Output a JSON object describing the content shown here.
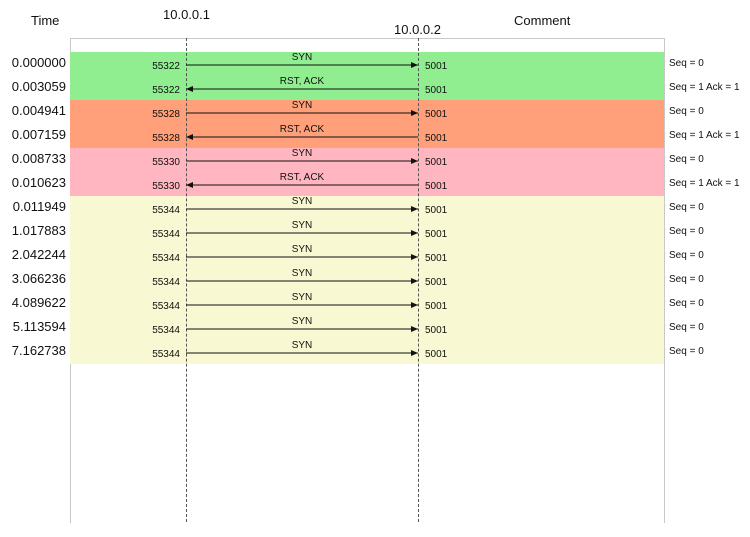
{
  "header": {
    "time_label": "Time",
    "host1": "10.0.0.1",
    "host2": "10.0.0.2",
    "comment_label": "Comment"
  },
  "colors": {
    "green": "#90ee90",
    "orange": "#ffa07a",
    "pink": "#ffb6c1",
    "yellow": "#f8f8d2"
  },
  "bands": [
    {
      "color": "#90ee90",
      "rows": 2
    },
    {
      "color": "#ffa07a",
      "rows": 2
    },
    {
      "color": "#ffb6c1",
      "rows": 2
    },
    {
      "color": "#f8f8d2",
      "rows": 7
    }
  ],
  "rows": [
    {
      "time": "0.000000",
      "src_port": "55322",
      "dst_port": "5001",
      "label": "SYN",
      "direction": "right",
      "comment": "Seq = 0"
    },
    {
      "time": "0.003059",
      "src_port": "55322",
      "dst_port": "5001",
      "label": "RST, ACK",
      "direction": "left",
      "comment": "Seq = 1 Ack = 1"
    },
    {
      "time": "0.004941",
      "src_port": "55328",
      "dst_port": "5001",
      "label": "SYN",
      "direction": "right",
      "comment": "Seq = 0"
    },
    {
      "time": "0.007159",
      "src_port": "55328",
      "dst_port": "5001",
      "label": "RST, ACK",
      "direction": "left",
      "comment": "Seq = 1 Ack = 1"
    },
    {
      "time": "0.008733",
      "src_port": "55330",
      "dst_port": "5001",
      "label": "SYN",
      "direction": "right",
      "comment": "Seq = 0"
    },
    {
      "time": "0.010623",
      "src_port": "55330",
      "dst_port": "5001",
      "label": "RST, ACK",
      "direction": "left",
      "comment": "Seq = 1 Ack = 1"
    },
    {
      "time": "0.011949",
      "src_port": "55344",
      "dst_port": "5001",
      "label": "SYN",
      "direction": "right",
      "comment": "Seq = 0"
    },
    {
      "time": "1.017883",
      "src_port": "55344",
      "dst_port": "5001",
      "label": "SYN",
      "direction": "right",
      "comment": "Seq = 0"
    },
    {
      "time": "2.042244",
      "src_port": "55344",
      "dst_port": "5001",
      "label": "SYN",
      "direction": "right",
      "comment": "Seq = 0"
    },
    {
      "time": "3.066236",
      "src_port": "55344",
      "dst_port": "5001",
      "label": "SYN",
      "direction": "right",
      "comment": "Seq = 0"
    },
    {
      "time": "4.089622",
      "src_port": "55344",
      "dst_port": "5001",
      "label": "SYN",
      "direction": "right",
      "comment": "Seq = 0"
    },
    {
      "time": "5.113594",
      "src_port": "55344",
      "dst_port": "5001",
      "label": "SYN",
      "direction": "right",
      "comment": "Seq = 0"
    },
    {
      "time": "7.162738",
      "src_port": "55344",
      "dst_port": "5001",
      "label": "SYN",
      "direction": "right",
      "comment": "Seq = 0"
    }
  ]
}
